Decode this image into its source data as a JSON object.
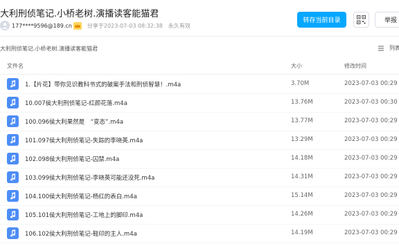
{
  "share": {
    "title": "大利刑侦笔记.小桥老树.演播读客能猫君",
    "user": "177****9596@189.cn",
    "shared_at": "分享于2023-07-03 08:32:38",
    "validity": "永久有效"
  },
  "toolbar": {
    "save_label": "转存当前目录",
    "report_label": "举报"
  },
  "breadcrumb": "大利刑侦笔记.小桥老树.演播读客能猫君",
  "view_toggle_label": "列表",
  "table": {
    "headers": {
      "name": "文件名",
      "size": "大小",
      "time": "修改时间"
    },
    "rows": [
      {
        "name": "1.【片花】带你见识教科书式的破案手法和刑侦智慧！.m4a",
        "size": "3.70M",
        "time": "2023-07-03 00:29"
      },
      {
        "name": "10.007侯大利刑侦笔记-红颜花落.m4a",
        "size": "13.76M",
        "time": "2023-07-03 00:30"
      },
      {
        "name": "100.096侯大利果然是　“变态”.m4a",
        "size": "13.77M",
        "time": "2023-07-03 00:29"
      },
      {
        "name": "101.097侯大利刑侦笔记-失踪的李晓英.m4a",
        "size": "13.29M",
        "time": "2023-07-03 00:29"
      },
      {
        "name": "102.098侯大利刑侦笔记-囚禁.m4a",
        "size": "14.18M",
        "time": "2023-07-03 00:29"
      },
      {
        "name": "103.099侯大利刑侦笔记-李晓英可能还没死.m4a",
        "size": "14.31M",
        "time": "2023-07-03 00:29"
      },
      {
        "name": "104.100侯大利刑侦笔记-杨红的表白.m4a",
        "size": "15.14M",
        "time": "2023-07-03 00:29"
      },
      {
        "name": "105.101侯大利刑侦笔记-工地上的脚印.m4a",
        "size": "14.26M",
        "time": "2023-07-03 00:29"
      },
      {
        "name": "106.102侯大利刑侦笔记-鞋印的主人.m4a",
        "size": "14.19M",
        "time": "2023-07-03 00:29"
      }
    ]
  },
  "icons": {
    "file": "audio-file-icon",
    "user": "user-avatar-icon",
    "vip": "vip-crown-icon",
    "qr": "qr-code-icon",
    "list": "list-view-icon"
  },
  "colors": {
    "accent": "#06a7ff",
    "file_icon": "#4d8df7",
    "vip": "#f7b500"
  }
}
